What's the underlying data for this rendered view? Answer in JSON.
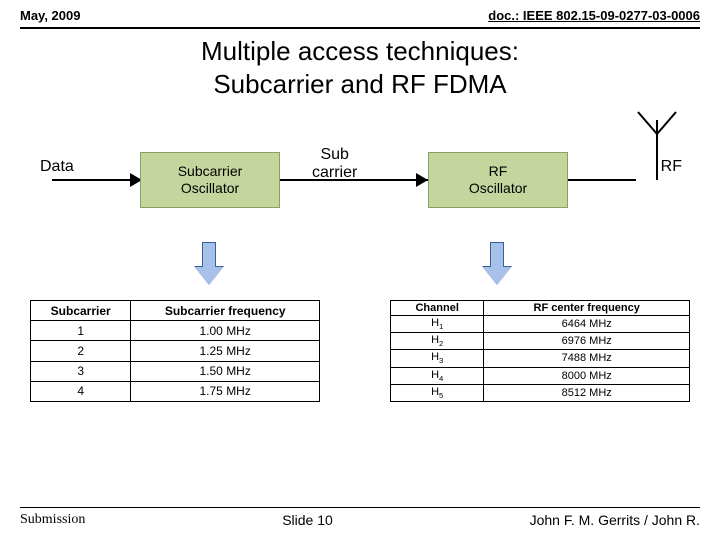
{
  "header": {
    "date": "May, 2009",
    "doc": "doc.: IEEE 802.15-09-0277-03-0006"
  },
  "title": {
    "line1": "Multiple access techniques:",
    "line2": "Subcarrier and RF FDMA"
  },
  "labels": {
    "data": "Data",
    "sub1": "Sub",
    "sub2": "carrier",
    "rf": "RF"
  },
  "blocks": {
    "osc1a": "Subcarrier",
    "osc1b": "Oscillator",
    "osc2a": "RF",
    "osc2b": "Oscillator"
  },
  "table1": {
    "h1": "Subcarrier",
    "h2": "Subcarrier frequency",
    "rows": [
      {
        "c1": "1",
        "c2": "1.00 MHz"
      },
      {
        "c1": "2",
        "c2": "1.25 MHz"
      },
      {
        "c1": "3",
        "c2": "1.50 MHz"
      },
      {
        "c1": "4",
        "c2": "1.75 MHz"
      }
    ]
  },
  "table2": {
    "h1": "Channel",
    "h2": "RF center frequency",
    "rows": [
      {
        "c1": "H",
        "s": "1",
        "c2": "6464 MHz"
      },
      {
        "c1": "H",
        "s": "2",
        "c2": "6976 MHz"
      },
      {
        "c1": "H",
        "s": "3",
        "c2": "7488 MHz"
      },
      {
        "c1": "H",
        "s": "4",
        "c2": "8000 MHz"
      },
      {
        "c1": "H",
        "s": "5",
        "c2": "8512 MHz"
      }
    ]
  },
  "footer": {
    "left": "Submission",
    "mid": "Slide 10",
    "right": "John F. M. Gerrits / John R."
  },
  "chart_data": [
    {
      "type": "table",
      "title": "Subcarrier frequency",
      "columns": [
        "Subcarrier",
        "Subcarrier frequency"
      ],
      "rows": [
        [
          1,
          "1.00 MHz"
        ],
        [
          2,
          "1.25 MHz"
        ],
        [
          3,
          "1.50 MHz"
        ],
        [
          4,
          "1.75 MHz"
        ]
      ]
    },
    {
      "type": "table",
      "title": "RF center frequency",
      "columns": [
        "Channel",
        "RF center frequency"
      ],
      "rows": [
        [
          "H1",
          "6464 MHz"
        ],
        [
          "H2",
          "6976 MHz"
        ],
        [
          "H3",
          "7488 MHz"
        ],
        [
          "H4",
          "8000 MHz"
        ],
        [
          "H5",
          "8512 MHz"
        ]
      ]
    }
  ]
}
